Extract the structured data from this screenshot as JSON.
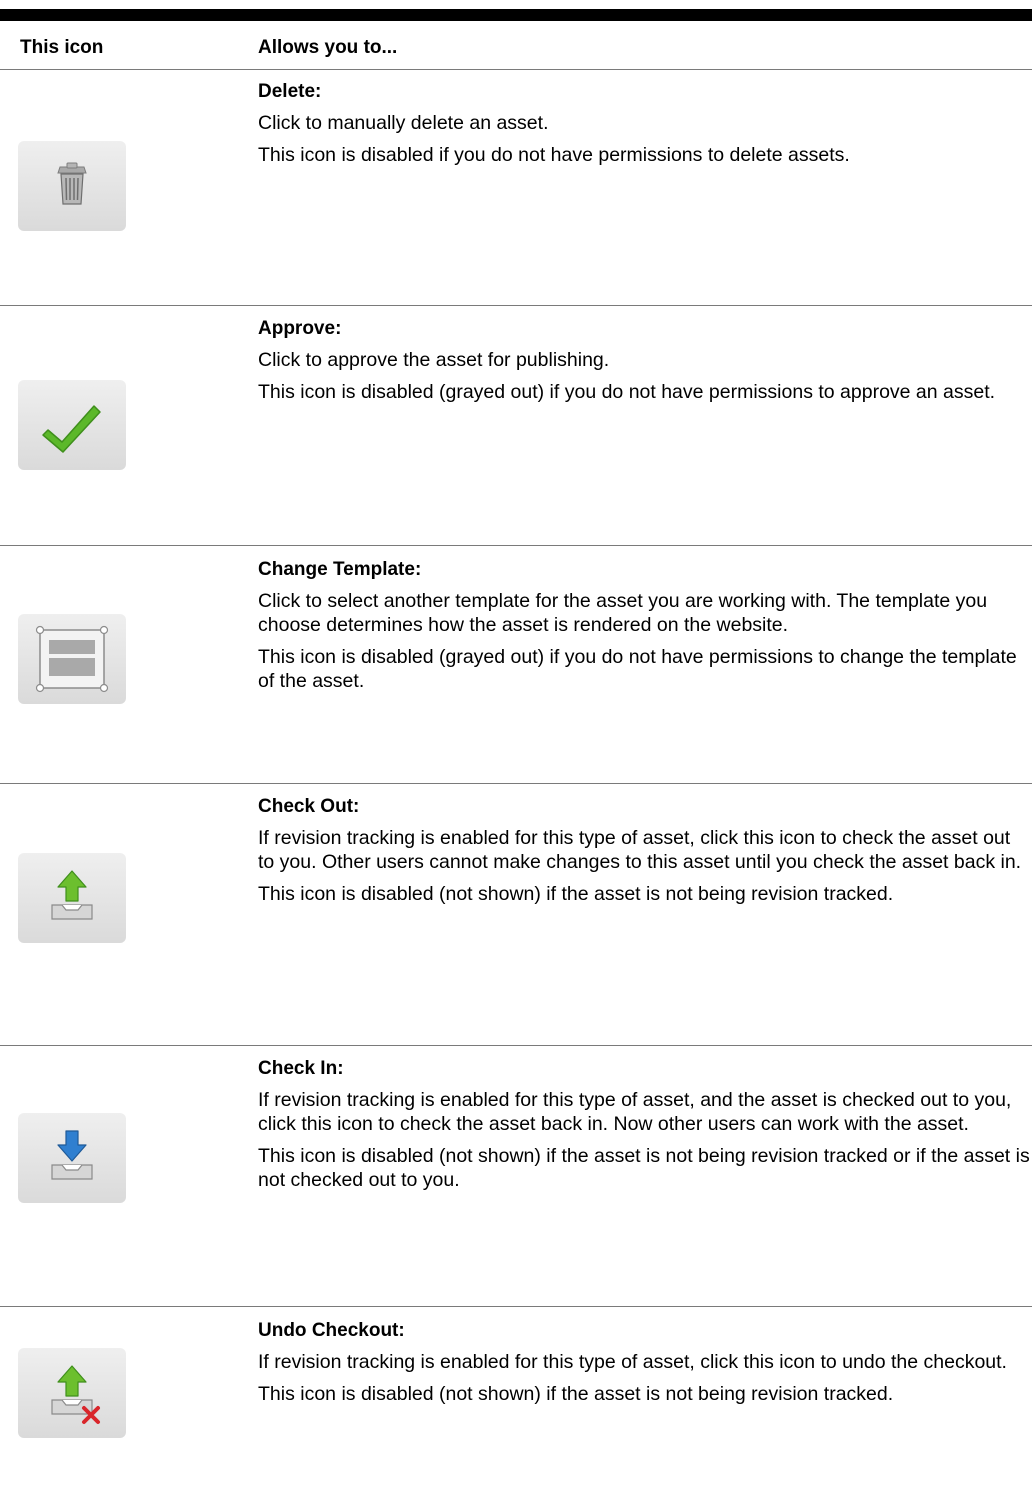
{
  "header": {
    "col_icon": "This icon",
    "col_desc": "Allows you to..."
  },
  "rows": [
    {
      "icon": "trash-icon",
      "title": "Delete:",
      "lines": [
        "Click to manually delete an asset.",
        "This icon is disabled if you do not have permissions to delete assets."
      ]
    },
    {
      "icon": "checkmark-icon",
      "title": "Approve:",
      "lines": [
        "Click to approve the asset for publishing.",
        "This icon is disabled (grayed out) if you do not have permissions to approve an asset."
      ]
    },
    {
      "icon": "template-icon",
      "title": "Change Template:",
      "lines": [
        "Click to select another template for the asset you are working with. The template you choose determines how the asset is rendered on the website.",
        "This icon is disabled (grayed out) if you do not have permissions to change the template of the asset."
      ]
    },
    {
      "icon": "check-out-icon",
      "title": "Check Out:",
      "lines": [
        "If revision tracking is enabled for this type of asset, click this icon to check the asset out to you. Other users cannot make changes to this asset until you check the asset back in.",
        "This icon is disabled (not shown) if the asset is not being revision tracked."
      ]
    },
    {
      "icon": "check-in-icon",
      "title": "Check In:",
      "lines": [
        "If revision tracking is enabled for this type of asset, and the asset is checked out to you, click this icon to check the asset back in. Now other users can work with the asset.",
        "This icon is disabled (not shown) if the asset is not being revision tracked or if the asset is not checked out to you."
      ]
    },
    {
      "icon": "undo-checkout-icon",
      "title": "Undo Checkout:",
      "lines": [
        "If revision tracking is enabled for this type of asset, click this icon to undo the checkout.",
        "This icon is disabled (not shown) if the asset is not being revision tracked."
      ]
    }
  ],
  "colors": {
    "check_green": "#5cb82a",
    "arrow_green": "#6cbf2e",
    "arrow_blue": "#2f7fd0",
    "cancel_red": "#d9262b"
  }
}
